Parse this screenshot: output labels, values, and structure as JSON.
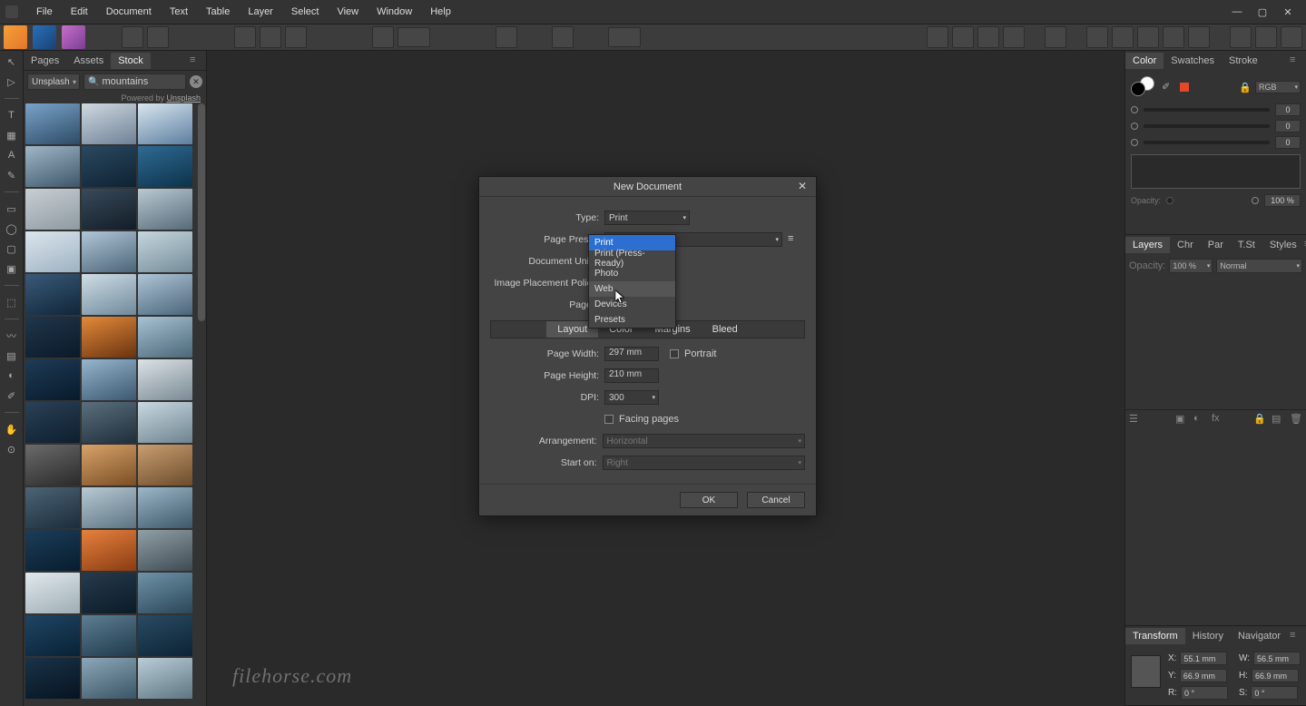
{
  "menubar": [
    "File",
    "Edit",
    "Document",
    "Text",
    "Table",
    "Layer",
    "Select",
    "View",
    "Window",
    "Help"
  ],
  "leftTabs": [
    "Pages",
    "Assets",
    "Stock"
  ],
  "leftActiveTab": "Stock",
  "stockSource": "Unsplash",
  "searchValue": "mountains",
  "powered": {
    "pre": "Powered by ",
    "link": "Unsplash"
  },
  "colorTabs": [
    "Color",
    "Swatches",
    "Stroke"
  ],
  "colorTabsActive": "Color",
  "colorVals": [
    "0",
    "0",
    "0"
  ],
  "colorMode": "RGB",
  "opacityLabel": "Opacity:",
  "opacityValue": "100 %",
  "layerTabs": [
    "Layers",
    "Chr",
    "Par",
    "T.St",
    "Styles"
  ],
  "layerTabsActive": "Layers",
  "layerOpacityLabel": "Opacity:",
  "layerOpacity": "100 %",
  "layerBlend": "Normal",
  "transformTabs": [
    "Transform",
    "History",
    "Navigator"
  ],
  "transformTabsActive": "Transform",
  "transform": {
    "x": "55.1 mm",
    "y": "66.9 mm",
    "w": "56.5 mm",
    "h": "66.9 mm",
    "r": "0 °",
    "s": "0 °"
  },
  "tfLabels": {
    "x": "X:",
    "y": "Y:",
    "w": "W:",
    "h": "H:",
    "r": "R:",
    "s": "S:"
  },
  "dialog": {
    "title": "New Document",
    "labels": {
      "type": "Type:",
      "preset": "Page Preset:",
      "units": "Document Units:",
      "placement": "Image Placement Policy:",
      "pages": "Pages:",
      "pw": "Page Width:",
      "ph": "Page Height:",
      "dpi": "DPI:",
      "facing": "Facing pages",
      "arrange": "Arrangement:",
      "start": "Start on:",
      "portrait": "Portrait"
    },
    "values": {
      "type": "Print",
      "pw": "297 mm",
      "ph": "210 mm",
      "dpi": "300",
      "arrange": "Horizontal",
      "start": "Right"
    },
    "tabs": [
      "Layout",
      "Color",
      "Margins",
      "Bleed"
    ],
    "activeTab": "Layout",
    "buttons": {
      "ok": "OK",
      "cancel": "Cancel"
    }
  },
  "dropdown": [
    "Print",
    "Print (Press-Ready)",
    "Photo",
    "Web",
    "Devices",
    "Presets"
  ],
  "dropdownSelected": "Print",
  "dropdownHover": "Web",
  "watermark": "filehorse.com",
  "thumbGradients": [
    [
      "#7aa3c9",
      "#2d4b66"
    ],
    [
      "#cfd9e1",
      "#6e8196"
    ],
    [
      "#d8e6ef",
      "#5c7ea0"
    ],
    [
      "#9fb7c7",
      "#3e5669"
    ],
    [
      "#2a495f",
      "#0e2232"
    ],
    [
      "#2f6a93",
      "#0d324a"
    ],
    [
      "#c8cfd3",
      "#8e9aa1"
    ],
    [
      "#394a5b",
      "#121d27"
    ],
    [
      "#b9c9d3",
      "#566a78"
    ],
    [
      "#dbe6ee",
      "#9eb2c1"
    ],
    [
      "#b0c7d8",
      "#4b6578"
    ],
    [
      "#c5d7df",
      "#748c98"
    ],
    [
      "#3a5a78",
      "#10263a"
    ],
    [
      "#cfdde6",
      "#6f8a9a"
    ],
    [
      "#aec5d6",
      "#4a657a"
    ],
    [
      "#20364a",
      "#0a1a29"
    ],
    [
      "#e38a3a",
      "#6a3310"
    ],
    [
      "#a7c2d2",
      "#4b6878"
    ],
    [
      "#1e3b56",
      "#081a2b"
    ],
    [
      "#96b6cd",
      "#3b5970"
    ],
    [
      "#dbe2e6",
      "#7a8a93"
    ],
    [
      "#2b4157",
      "#0d1e2e"
    ],
    [
      "#5b6f7e",
      "#1f2e3a"
    ],
    [
      "#c9d8e1",
      "#6e8490"
    ],
    [
      "#6b6b6b",
      "#2a2a2a"
    ],
    [
      "#d8a36b",
      "#7a4e24"
    ],
    [
      "#c99e70",
      "#6c4c2c"
    ],
    [
      "#4c6476",
      "#1b2d3a"
    ],
    [
      "#b8cad4",
      "#5c7482"
    ],
    [
      "#9cb7c8",
      "#3d5868"
    ],
    [
      "#1c3d58",
      "#071d2f"
    ],
    [
      "#e6813e",
      "#8a3c12"
    ],
    [
      "#919fa7",
      "#3e4b53"
    ],
    [
      "#e1e9ed",
      "#9eadb4"
    ],
    [
      "#263b4d",
      "#0b1a27"
    ],
    [
      "#6f93a8",
      "#2b4658"
    ],
    [
      "#1f4563",
      "#092236"
    ],
    [
      "#5d7e93",
      "#1f3a4b"
    ],
    [
      "#2a4b63",
      "#0c2335"
    ],
    [
      "#1a3248",
      "#061421"
    ],
    [
      "#8ba8ba",
      "#3a5565"
    ],
    [
      "#b9cdd7",
      "#5e7682"
    ]
  ]
}
